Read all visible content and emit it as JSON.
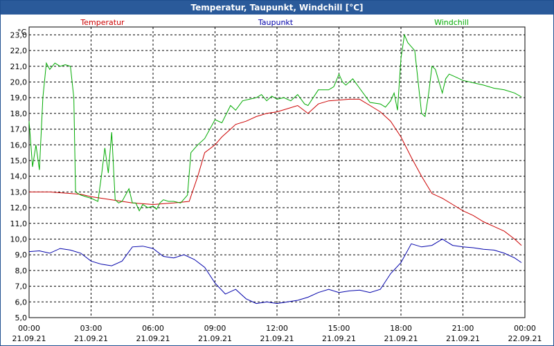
{
  "window": {
    "title": "Temperatur, Taupunkt, Windchill [°C]"
  },
  "chart_data": {
    "type": "line",
    "title": "Temperatur, Taupunkt, Windchill [°C]",
    "ylabel": "°C",
    "ylim": [
      5.0,
      23.5
    ],
    "xlim": [
      "2021-09-21 00:00",
      "2021-09-22 00:00"
    ],
    "yticks": [
      "5,0",
      "6,0",
      "7,0",
      "8,0",
      "9,0",
      "10,0",
      "11,0",
      "12,0",
      "13,0",
      "14,0",
      "15,0",
      "16,0",
      "17,0",
      "18,0",
      "19,0",
      "20,0",
      "21,0",
      "22,0",
      "23,0"
    ],
    "xticks": [
      {
        "time": "00:00",
        "date": "21.09.21"
      },
      {
        "time": "03:00",
        "date": "21.09.21"
      },
      {
        "time": "06:00",
        "date": "21.09.21"
      },
      {
        "time": "09:00",
        "date": "21.09.21"
      },
      {
        "time": "12:00",
        "date": "21.09.21"
      },
      {
        "time": "15:00",
        "date": "21.09.21"
      },
      {
        "time": "18:00",
        "date": "21.09.21"
      },
      {
        "time": "21:00",
        "date": "21.09.21"
      },
      {
        "time": "00:00",
        "date": "22.09.21"
      }
    ],
    "grid": true,
    "legend_position": "top",
    "series": [
      {
        "name": "Temperatur",
        "color": "#cc0000",
        "x": [
          "00:00",
          "01:00",
          "02:00",
          "02:30",
          "03:00",
          "04:00",
          "05:00",
          "06:00",
          "07:00",
          "07:45",
          "08:10",
          "08:30",
          "09:00",
          "09:20",
          "09:45",
          "10:00",
          "10:30",
          "11:00",
          "11:30",
          "12:00",
          "12:30",
          "13:00",
          "13:30",
          "14:00",
          "14:30",
          "15:00",
          "15:30",
          "16:00",
          "16:30",
          "17:00",
          "17:30",
          "18:00",
          "18:30",
          "19:00",
          "19:30",
          "20:00",
          "20:30",
          "21:00",
          "21:30",
          "22:00",
          "22:30",
          "23:00",
          "23:30",
          "23:50"
        ],
        "y": [
          13.0,
          13.0,
          12.9,
          12.85,
          12.7,
          12.5,
          12.3,
          12.2,
          12.3,
          12.4,
          14.0,
          15.5,
          16.0,
          16.5,
          17.0,
          17.3,
          17.5,
          17.8,
          18.0,
          18.1,
          18.3,
          18.5,
          18.0,
          18.6,
          18.8,
          18.85,
          18.9,
          18.9,
          18.5,
          18.1,
          17.5,
          16.5,
          15.2,
          14.0,
          12.9,
          12.6,
          12.2,
          11.8,
          11.5,
          11.1,
          10.8,
          10.5,
          10.0,
          9.6
        ]
      },
      {
        "name": "Taupunkt",
        "color": "#0000aa",
        "x": [
          "00:00",
          "00:30",
          "01:00",
          "01:30",
          "02:00",
          "02:30",
          "03:00",
          "03:30",
          "04:00",
          "04:30",
          "05:00",
          "05:30",
          "06:00",
          "06:30",
          "07:00",
          "07:30",
          "08:00",
          "08:30",
          "09:00",
          "09:30",
          "10:00",
          "10:30",
          "11:00",
          "11:30",
          "12:00",
          "12:30",
          "13:00",
          "13:30",
          "14:00",
          "14:30",
          "15:00",
          "15:30",
          "16:00",
          "16:30",
          "17:00",
          "17:30",
          "18:00",
          "18:30",
          "19:00",
          "19:30",
          "20:00",
          "20:30",
          "21:00",
          "21:30",
          "22:00",
          "22:30",
          "23:00",
          "23:30",
          "23:50"
        ],
        "y": [
          9.2,
          9.25,
          9.1,
          9.4,
          9.3,
          9.1,
          8.6,
          8.4,
          8.3,
          8.6,
          9.5,
          9.55,
          9.4,
          8.9,
          8.8,
          9.0,
          8.7,
          8.2,
          7.2,
          6.5,
          6.8,
          6.2,
          5.9,
          6.0,
          5.9,
          6.0,
          6.1,
          6.3,
          6.6,
          6.8,
          6.6,
          6.7,
          6.75,
          6.6,
          6.8,
          7.8,
          8.5,
          9.7,
          9.5,
          9.6,
          10.0,
          9.6,
          9.5,
          9.45,
          9.35,
          9.3,
          9.1,
          8.8,
          8.5
        ]
      },
      {
        "name": "Windchill",
        "color": "#00aa00",
        "x": [
          "00:00",
          "00:10",
          "00:20",
          "00:30",
          "00:40",
          "00:50",
          "01:00",
          "01:15",
          "01:30",
          "01:45",
          "02:00",
          "02:10",
          "02:15",
          "02:30",
          "03:00",
          "03:20",
          "03:30",
          "03:40",
          "03:50",
          "04:00",
          "04:10",
          "04:20",
          "04:30",
          "04:50",
          "05:00",
          "05:10",
          "05:20",
          "05:30",
          "05:45",
          "06:00",
          "06:10",
          "06:20",
          "06:30",
          "06:45",
          "07:00",
          "07:20",
          "07:40",
          "07:50",
          "08:10",
          "08:30",
          "09:00",
          "09:20",
          "09:45",
          "10:00",
          "10:20",
          "10:40",
          "11:00",
          "11:15",
          "11:30",
          "11:45",
          "12:00",
          "12:20",
          "12:40",
          "13:00",
          "13:20",
          "13:30",
          "14:00",
          "14:30",
          "14:45",
          "15:00",
          "15:10",
          "15:20",
          "15:40",
          "16:00",
          "16:20",
          "16:30",
          "17:00",
          "17:15",
          "17:30",
          "17:40",
          "17:50",
          "18:00",
          "18:10",
          "18:20",
          "18:40",
          "19:00",
          "19:10",
          "19:20",
          "19:30",
          "19:40",
          "20:00",
          "20:10",
          "20:20",
          "20:40",
          "21:00",
          "21:30",
          "22:00",
          "22:30",
          "23:00",
          "23:30",
          "23:50"
        ],
        "y": [
          17.5,
          14.6,
          16.0,
          14.4,
          19.0,
          21.2,
          20.8,
          21.2,
          21.0,
          21.1,
          21.0,
          19.0,
          13.0,
          12.8,
          12.6,
          12.4,
          14.0,
          15.8,
          14.2,
          16.8,
          12.5,
          12.3,
          12.4,
          13.2,
          12.3,
          12.3,
          11.8,
          12.2,
          12.0,
          12.1,
          11.9,
          12.3,
          12.5,
          12.4,
          12.4,
          12.3,
          12.8,
          15.5,
          16.0,
          16.4,
          17.6,
          17.4,
          18.5,
          18.2,
          18.8,
          18.9,
          19.0,
          19.2,
          18.8,
          19.1,
          18.9,
          19.0,
          18.8,
          19.2,
          18.6,
          18.5,
          19.5,
          19.5,
          19.7,
          20.5,
          20.0,
          19.8,
          20.2,
          19.6,
          19.0,
          18.7,
          18.6,
          18.4,
          18.8,
          19.3,
          18.2,
          21.5,
          23.0,
          22.5,
          22.0,
          18.0,
          17.8,
          19.2,
          21.0,
          20.8,
          19.3,
          20.2,
          20.5,
          20.3,
          20.1,
          19.95,
          19.8,
          19.6,
          19.5,
          19.3,
          19.05
        ]
      }
    ]
  }
}
